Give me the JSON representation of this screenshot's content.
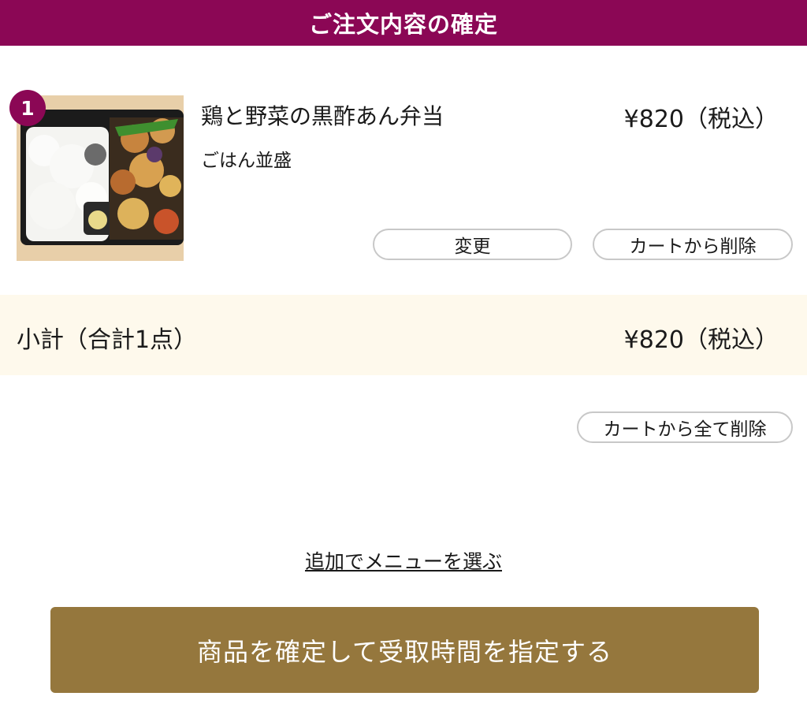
{
  "header": {
    "title": "ご注文内容の確定"
  },
  "item": {
    "index": "1",
    "name": "鶏と野菜の黒酢あん弁当",
    "option": "ごはん並盛",
    "price": "¥820（税込）",
    "change_label": "変更",
    "remove_label": "カートから削除"
  },
  "subtotal": {
    "label": "小計（合計1点）",
    "price": "¥820（税込）"
  },
  "cart": {
    "clear_label": "カートから全て削除"
  },
  "actions": {
    "add_menu_label": "追加でメニューを選ぶ",
    "confirm_label": "商品を確定して受取時間を指定する"
  },
  "colors": {
    "header": "#8b0755",
    "confirm": "#95773d",
    "subtotal_bg": "#fef9ec"
  }
}
